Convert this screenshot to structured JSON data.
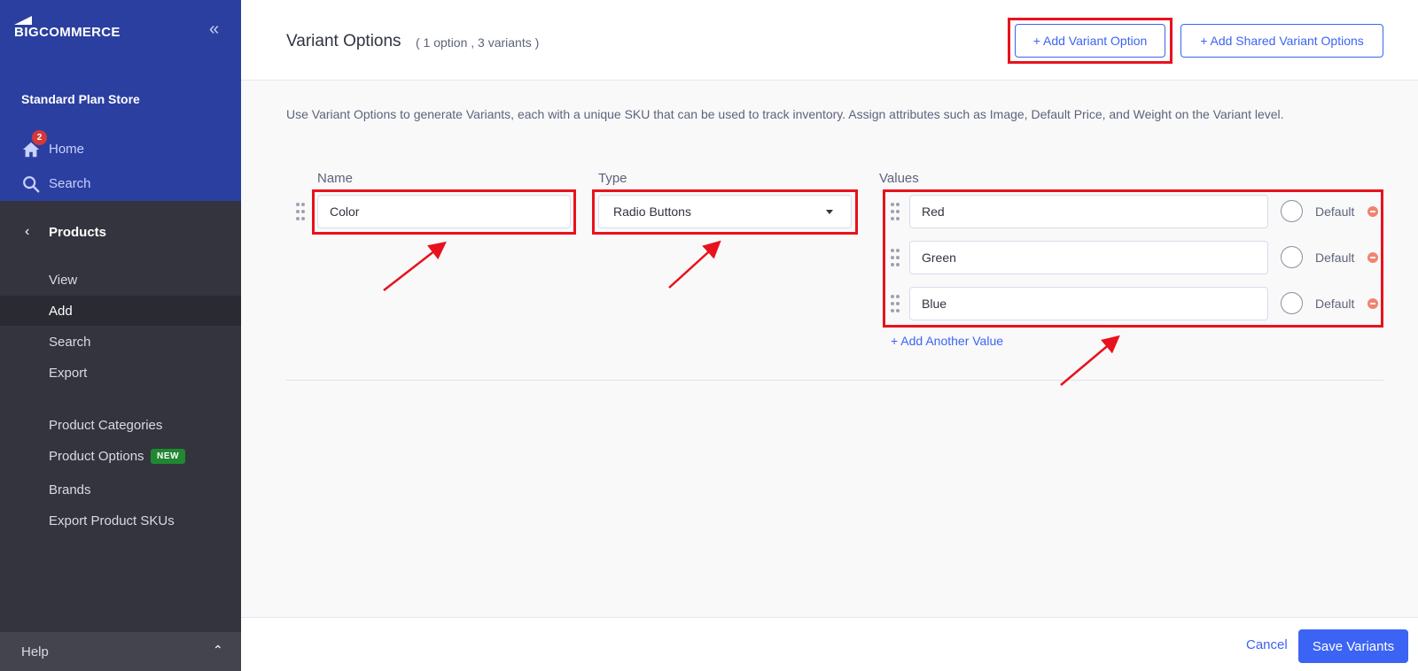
{
  "brand": {
    "logo_big": "BIG",
    "logo_rest": "COMMERCE"
  },
  "sidebar": {
    "collapse_glyph": "«",
    "store_name": "Standard Plan Store",
    "home": {
      "label": "Home",
      "badge": "2",
      "icon": "home-icon"
    },
    "search": {
      "label": "Search",
      "icon": "search-icon"
    },
    "section": {
      "label": "Products",
      "chevron": "‹"
    },
    "items": [
      {
        "label": "View"
      },
      {
        "label": "Add"
      },
      {
        "label": "Search"
      },
      {
        "label": "Export"
      },
      {
        "label": "Product Categories"
      },
      {
        "label": "Product Options",
        "badge": "NEW"
      },
      {
        "label": "Brands"
      },
      {
        "label": "Export Product SKUs"
      }
    ],
    "help": {
      "label": "Help",
      "caret": "⌃"
    }
  },
  "header": {
    "title": "Variant Options",
    "subtitle": "( 1 option , 3 variants )",
    "add_variant_option": "+ Add Variant Option",
    "add_shared_variant_options": "+ Add Shared Variant Options"
  },
  "description": "Use Variant Options to generate Variants, each with a unique SKU that can be used to track inventory. Assign attributes such as Image, Default Price, and Weight on the Variant level.",
  "option": {
    "name_label": "Name",
    "type_label": "Type",
    "values_label": "Values",
    "name_value": "Color",
    "type_value": "Radio Buttons",
    "values": [
      {
        "value": "Red",
        "default_label": "Default"
      },
      {
        "value": "Green",
        "default_label": "Default"
      },
      {
        "value": "Blue",
        "default_label": "Default"
      }
    ],
    "add_another_value": "+ Add Another Value"
  },
  "footer": {
    "cancel": "Cancel",
    "save": "Save Variants"
  },
  "colors": {
    "sidebar_top": "#2b3fa0",
    "sidebar": "#34343f",
    "primary": "#3c64f4",
    "highlight": "#e8121c",
    "new_badge": "#208831"
  }
}
